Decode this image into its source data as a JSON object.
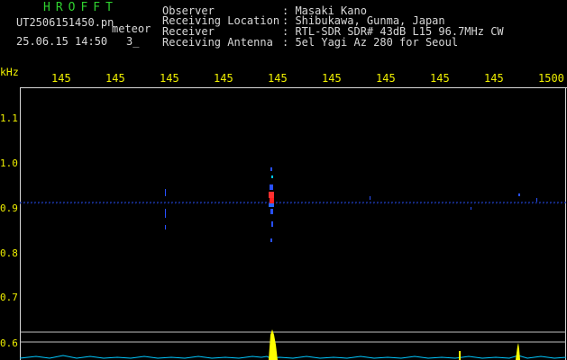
{
  "header": {
    "brand": "HROFFT",
    "filename": "UT2506151450.pn",
    "mode": "meteor",
    "datetime": "25.06.15 14:50",
    "count": "3_",
    "fields": [
      {
        "label": "Observer",
        "value": ": Masaki Kano"
      },
      {
        "label": "Receiving Location",
        "value": ": Shibukawa, Gunma, Japan"
      },
      {
        "label": "Receiver",
        "value": ": RTL-SDR SDR# 43dB L15 96.7MHz CW"
      },
      {
        "label": "Receiving Antenna",
        "value": ": 5el Yagi Az 280 for Seoul"
      }
    ]
  },
  "axis": {
    "y_unit": "kHz",
    "x_ticks": [
      "145",
      "145",
      "145",
      "145",
      "145",
      "145",
      "145",
      "145",
      "145",
      "1500"
    ],
    "y_ticks": [
      "1.1",
      "1.0",
      "0.9",
      "0.8",
      "0.7",
      "0.6"
    ]
  },
  "colors": {
    "background": "#000000",
    "header_text": "#d8d8d8",
    "brand": "#2fd12f",
    "axis_labels": "#f0f000",
    "carrier": "#2850ff",
    "echo": "#ff2020",
    "baseline": "#00c8ff",
    "peak": "#ffff00"
  }
}
